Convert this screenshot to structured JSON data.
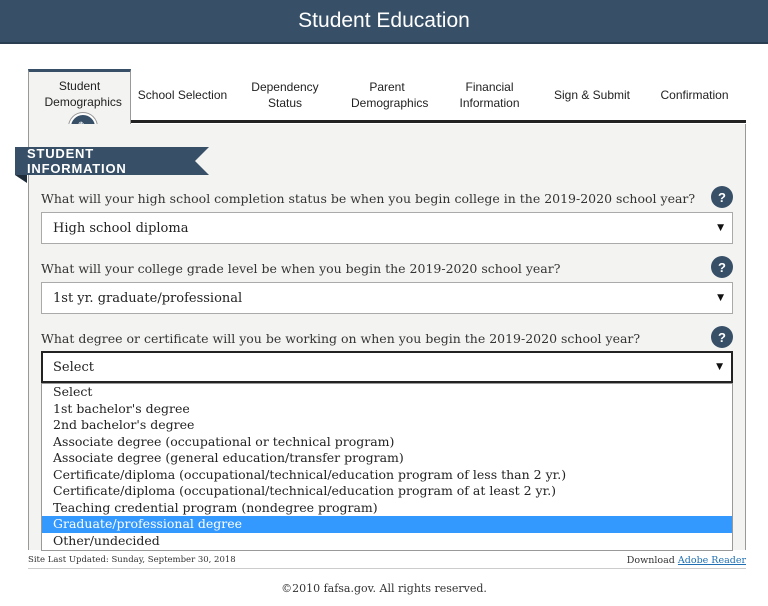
{
  "header": {
    "title": "Student Education"
  },
  "tabs": [
    {
      "label": "Student Demographics"
    },
    {
      "label": "School Selection"
    },
    {
      "label": "Dependency Status"
    },
    {
      "label": "Parent Demographics"
    },
    {
      "label": "Financial Information"
    },
    {
      "label": "Sign & Submit"
    },
    {
      "label": "Confirmation"
    }
  ],
  "section": {
    "title": "STUDENT INFORMATION"
  },
  "questions": [
    {
      "label": "What will your high school completion status be when you begin college in the 2019-2020 school year?",
      "value": "High school diploma"
    },
    {
      "label": "What will your college grade level be when you begin the 2019-2020 school year?",
      "value": "1st yr. graduate/professional"
    },
    {
      "label": "What degree or certificate will you be working on when you begin the 2019-2020 school year?",
      "value": "Select"
    }
  ],
  "help_glyph": "?",
  "dropdown": {
    "options": [
      "Select",
      "1st bachelor's degree",
      "2nd bachelor's degree",
      "Associate degree (occupational or technical program)",
      "Associate degree (general education/transfer program)",
      "Certificate/diploma (occupational/technical/education program of less than 2 yr.)",
      "Certificate/diploma (occupational/technical/education program of at least 2 yr.)",
      "Teaching credential program (nondegree program)",
      "Graduate/professional degree",
      "Other/undecided"
    ],
    "highlighted": "Graduate/professional degree"
  },
  "footer": {
    "updated": "Site Last Updated: Sunday, September 30, 2018",
    "download_prefix": "Download",
    "download_link": "Adobe Reader",
    "copyright": "©2010 fafsa.gov. All rights reserved."
  },
  "colors": {
    "primary": "#375068",
    "highlight": "#3399ff",
    "panel": "#f3f3f1"
  },
  "icons": {
    "edit": "pencil-icon",
    "help": "help-icon",
    "dropdown": "triangle-down-icon"
  }
}
